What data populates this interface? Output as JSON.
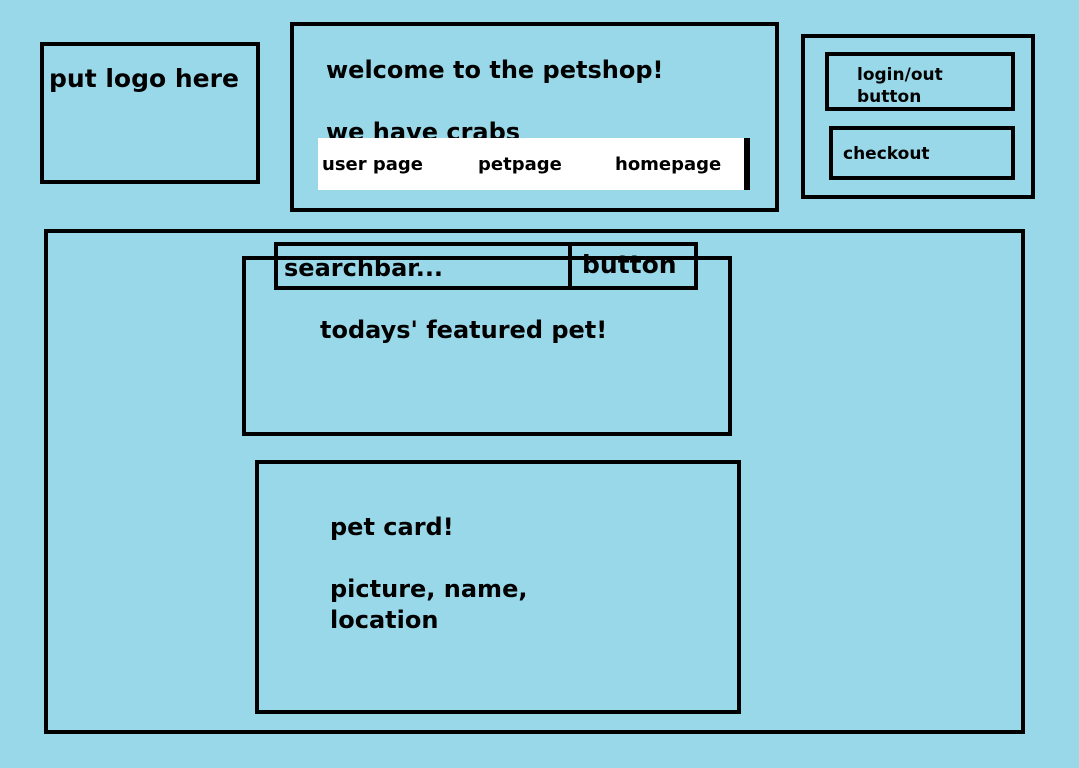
{
  "logo": {
    "placeholder_text": "put logo here"
  },
  "header": {
    "welcome": "welcome to the petshop!",
    "tagline": "we have crabs",
    "nav": {
      "user_page": "user page",
      "pet_page": "petpage",
      "home_page": "homepage"
    }
  },
  "auth": {
    "login_label": "login/out button",
    "checkout_label": "checkout"
  },
  "search": {
    "placeholder": "searchbar...",
    "button_label": "button"
  },
  "featured": {
    "title": "todays' featured pet!"
  },
  "pet_card": {
    "title": "pet card!",
    "details": "picture, name, location"
  },
  "colors": {
    "background": "#99d8e9",
    "border": "#000000",
    "nav_background": "#ffffff"
  }
}
